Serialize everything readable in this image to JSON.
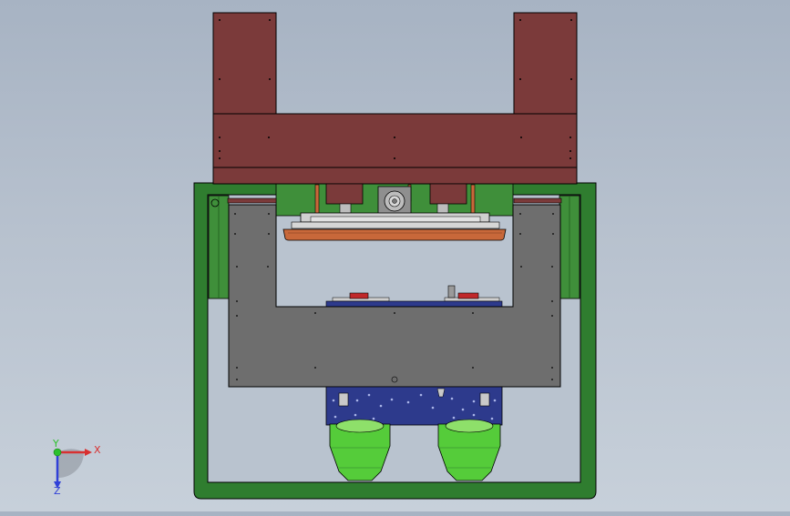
{
  "viewport": {
    "background_top": "#a7b3c3",
    "background_bottom": "#c7d0da"
  },
  "colors": {
    "frame_green": "#2f7d2f",
    "frame_green_light": "#4c9a3c",
    "maroon": "#7b3a3a",
    "steel_gray": "#6e6e6e",
    "orange_plate": "#c8683a",
    "blue_block": "#2d3a8c",
    "nozzle_green": "#55cc3a",
    "red_part": "#c0282a",
    "light_gray": "#c9c9c9"
  },
  "triad": {
    "x_label": "X",
    "y_label": "Y",
    "z_label": "Z",
    "x_color": "#d83030",
    "y_color": "#2cc02c",
    "z_color": "#3040d8"
  }
}
